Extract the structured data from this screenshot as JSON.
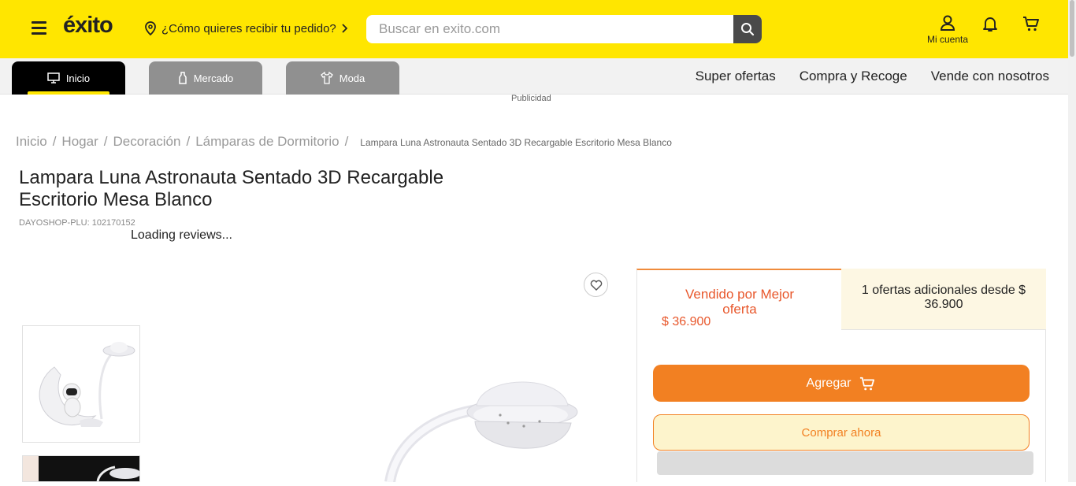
{
  "header": {
    "logo": "éxito",
    "location_prompt": "¿Cómo quieres recibir tu pedido?",
    "search_placeholder": "Buscar en exito.com",
    "account_label": "Mi cuenta",
    "brand_color": "#ffe600"
  },
  "nav": {
    "tabs": [
      {
        "label": "Inicio",
        "icon": "monitor-icon"
      },
      {
        "label": "Mercado",
        "icon": "bottle-icon"
      },
      {
        "label": "Moda",
        "icon": "shirt-icon"
      }
    ],
    "links": [
      "Super ofertas",
      "Compra y Recoge",
      "Vende con nosotros"
    ],
    "ad_label": "Publicidad"
  },
  "breadcrumb": {
    "items": [
      "Inicio",
      "Hogar",
      "Decoración",
      "Lámparas de Dormitorio"
    ],
    "current": "Lampara Luna Astronauta Sentado 3D Recargable Escritorio Mesa Blanco"
  },
  "product": {
    "title": "Lampara Luna Astronauta Sentado 3D Recargable Escritorio Mesa Blanco",
    "plu": "DAYOSHOP-PLU: 102170152",
    "reviews_status": "Loading reviews..."
  },
  "buybox": {
    "seller": "Vendido por Mejor oferta",
    "price": "$ 36.900",
    "other_offers": "1 ofertas adicionales desde $ 36.900",
    "add_label": "Agregar",
    "buy_now_label": "Comprar ahora",
    "accent_color": "#f28022"
  }
}
